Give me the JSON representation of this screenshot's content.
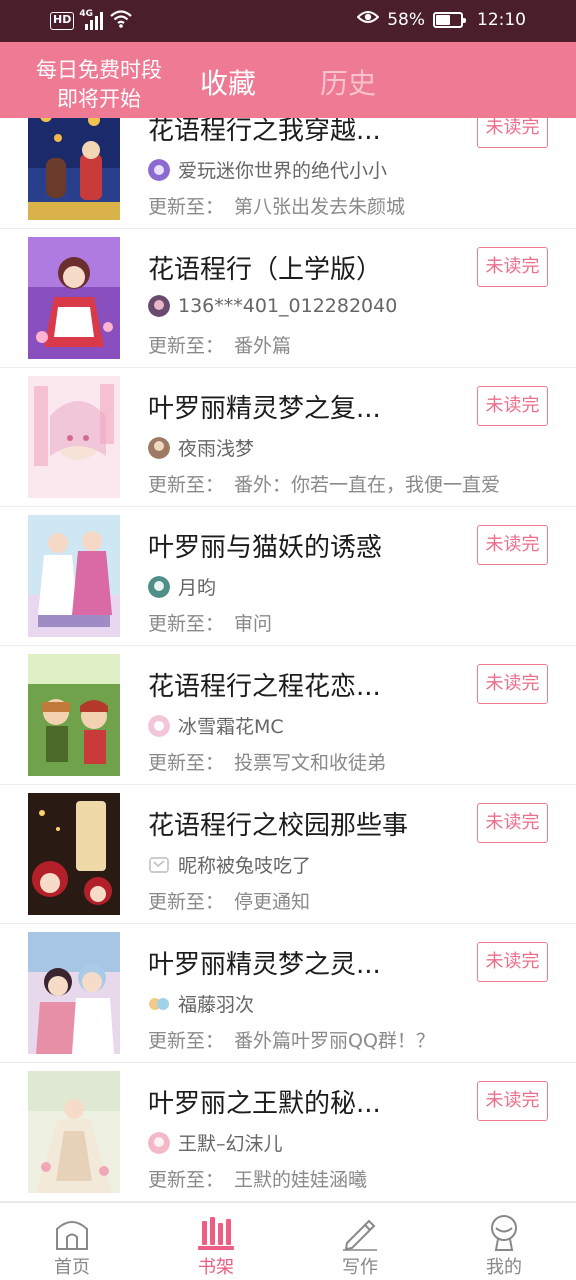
{
  "status_bar": {
    "network": "HD",
    "signal_type": "4G",
    "battery_percent": "58%",
    "battery_level": 0.58,
    "time": "12:10"
  },
  "header": {
    "promo_line1": "每日免费时段",
    "promo_line2": "即将开始",
    "tabs": [
      {
        "label": "收藏",
        "active": true
      },
      {
        "label": "历史",
        "active": false
      }
    ]
  },
  "colors": {
    "brand_pink": "#ef7a94",
    "status_bar": "#4a1f2b",
    "active_nav": "#ec5f83"
  },
  "books": [
    {
      "title": "花语程行之我穿越...",
      "author": "爱玩迷你世界的绝代小小",
      "update_label": "更新至：",
      "update_text": "第八张出发去朱颜城",
      "badge": "未读完"
    },
    {
      "title": "花语程行（上学版）",
      "author": "136***401_012282040",
      "update_label": "更新至：",
      "update_text": "番外篇",
      "badge": "未读完"
    },
    {
      "title": "叶罗丽精灵梦之复...",
      "author": "夜雨浅梦",
      "update_label": "更新至：",
      "update_text": "番外：你若一直在，我便一直爱",
      "badge": "未读完"
    },
    {
      "title": "叶罗丽与猫妖的诱惑",
      "author": "月昀",
      "update_label": "更新至：",
      "update_text": "审问",
      "badge": "未读完"
    },
    {
      "title": "花语程行之程花恋...",
      "author": "冰雪霜花MC",
      "update_label": "更新至：",
      "update_text": "投票写文和收徒弟",
      "badge": "未读完"
    },
    {
      "title": "花语程行之校园那些事",
      "author": "昵称被兔吱吃了",
      "update_label": "更新至：",
      "update_text": "停更通知",
      "badge": "未读完"
    },
    {
      "title": "叶罗丽精灵梦之灵...",
      "author": "福藤羽次",
      "update_label": "更新至：",
      "update_text": "番外篇叶罗丽QQ群！？",
      "badge": "未读完"
    },
    {
      "title": "叶罗丽之王默的秘...",
      "author": "王默–幻沫儿",
      "update_label": "更新至：",
      "update_text": "王默的娃娃涵曦",
      "badge": "未读完"
    }
  ],
  "bottom_nav": [
    {
      "label": "首页",
      "icon": "home-icon",
      "active": false
    },
    {
      "label": "书架",
      "icon": "bookshelf-icon",
      "active": true
    },
    {
      "label": "写作",
      "icon": "pen-icon",
      "active": false
    },
    {
      "label": "我的",
      "icon": "profile-icon",
      "active": false
    }
  ]
}
